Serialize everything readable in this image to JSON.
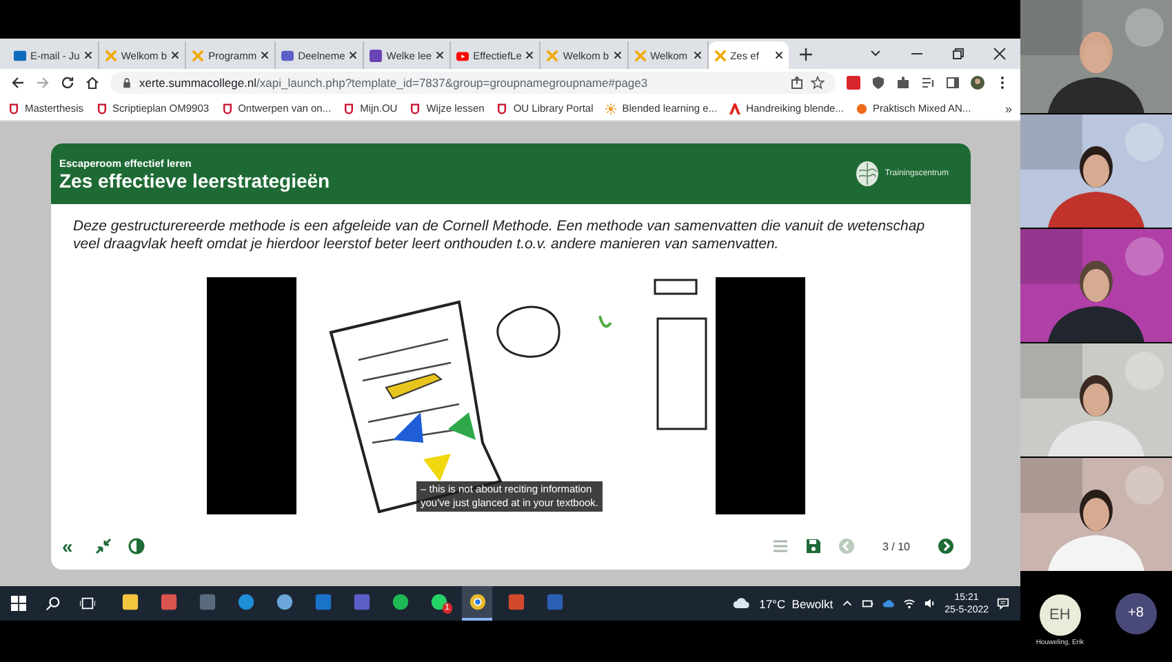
{
  "browser": {
    "tabs": [
      {
        "label": "E-mail - Ju",
        "kind": "outlook",
        "selected": false
      },
      {
        "label": "Welkom b",
        "kind": "xerte",
        "selected": false
      },
      {
        "label": "Programm",
        "kind": "xerte",
        "selected": false
      },
      {
        "label": "Deelneme",
        "kind": "teams",
        "selected": false
      },
      {
        "label": "Welke lee",
        "kind": "forms",
        "selected": false
      },
      {
        "label": "EffectiefLe",
        "kind": "youtube",
        "selected": false
      },
      {
        "label": "Welkom b",
        "kind": "xerte",
        "selected": false
      },
      {
        "label": "Welkom",
        "kind": "xerte",
        "selected": false
      },
      {
        "label": "Zes ef",
        "kind": "xerte",
        "selected": true
      }
    ],
    "url_host": "xerte.summacollege.nl",
    "url_path": "/xapi_launch.php?template_id=7837&group=groupnamegroupname#page3",
    "bookmarks": [
      {
        "label": "Masterthesis",
        "kind": "ou"
      },
      {
        "label": "Scriptieplan OM9903",
        "kind": "ou"
      },
      {
        "label": "Ontwerpen van on...",
        "kind": "ou"
      },
      {
        "label": "Mijn.OU",
        "kind": "ou"
      },
      {
        "label": "Wijze lessen",
        "kind": "ou"
      },
      {
        "label": "OU Library Portal",
        "kind": "ou"
      },
      {
        "label": "Blended learning e...",
        "kind": "sun"
      },
      {
        "label": "Handreiking blende...",
        "kind": "adobe"
      },
      {
        "label": "Praktisch Mixed AN...",
        "kind": "orange"
      }
    ],
    "bookmarks_more": "»"
  },
  "slide": {
    "subtitle": "Escaperoom effectief leren",
    "title": "Zes effectieve leerstrategieën",
    "logo_text": "Trainingscentrum",
    "paragraph": "Deze gestructurereerde methode is een afgeleide van de Cornell Methode. Een methode van samenvatten die vanuit de wetenschap veel draagvlak heeft omdat je hierdoor leerstof beter leert onthouden t.o.v. andere manieren van samenvatten.",
    "video": {
      "kind": "picture",
      "caption": [
        "– this is not about reciting information",
        "you've just glanced at in your textbook."
      ]
    },
    "toolbar_left": [
      {
        "kind": "collapse",
        "label": "«"
      },
      {
        "kind": "shrink"
      },
      {
        "kind": "contrast"
      }
    ],
    "toolbar_right": [
      {
        "kind": "menu",
        "disabled": true
      },
      {
        "kind": "save",
        "disabled": false
      },
      {
        "kind": "prev",
        "disabled": true
      }
    ],
    "page": "3 / 10",
    "next": {
      "disabled": false
    }
  },
  "taskbar": {
    "apps": [
      {
        "kind": "explorer",
        "selected": false
      },
      {
        "kind": "paint",
        "selected": false
      },
      {
        "kind": "calculator",
        "selected": false
      },
      {
        "kind": "edge",
        "selected": false
      },
      {
        "kind": "globe",
        "selected": false
      },
      {
        "kind": "outlook",
        "selected": false
      },
      {
        "kind": "teams",
        "selected": false
      },
      {
        "kind": "spotify",
        "selected": false
      },
      {
        "kind": "whatsapp",
        "selected": false,
        "badge": "1"
      },
      {
        "kind": "chrome",
        "selected": true
      },
      {
        "kind": "powerpoint",
        "selected": false
      },
      {
        "kind": "word",
        "selected": false
      }
    ],
    "weather": "17°C  Bewolkt",
    "time": "15:21",
    "date": "25-5-2022"
  },
  "self": {
    "initials": "EH",
    "name": "Houweling, Erik"
  },
  "more": "+8"
}
